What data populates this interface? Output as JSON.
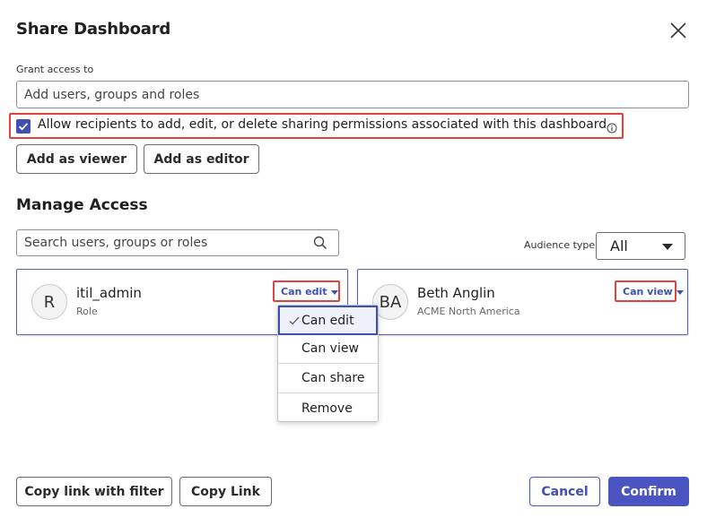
{
  "dialog": {
    "title": "Share Dashboard",
    "close_icon": "close-icon"
  },
  "grant": {
    "label": "Grant access to",
    "placeholder": "Add users, groups and roles"
  },
  "permission_option": {
    "checked": true,
    "label": "Allow recipients to add, edit, or delete sharing permissions associated with this dashboard",
    "info_icon": "info-icon"
  },
  "actions": {
    "add_viewer": "Add as viewer",
    "add_editor": "Add as editor"
  },
  "manage": {
    "title": "Manage Access",
    "search_placeholder": "Search users, groups or roles",
    "audience_label": "Audience type",
    "audience_value": "All"
  },
  "cards": [
    {
      "initials": "R",
      "name": "itil_admin",
      "sub": "Role",
      "permission": "Can edit"
    },
    {
      "initials": "BA",
      "name": "Beth Anglin",
      "sub": "ACME North America",
      "permission": "Can view"
    }
  ],
  "permission_menu": {
    "items": [
      "Can edit",
      "Can view",
      "Can share",
      "Remove"
    ],
    "selected": "Can edit"
  },
  "footer": {
    "copy_filter": "Copy link with filter",
    "copy_link": "Copy Link",
    "cancel": "Cancel",
    "confirm": "Confirm"
  },
  "colors": {
    "accent": "#4a55c2",
    "highlight": "#e0443e"
  }
}
